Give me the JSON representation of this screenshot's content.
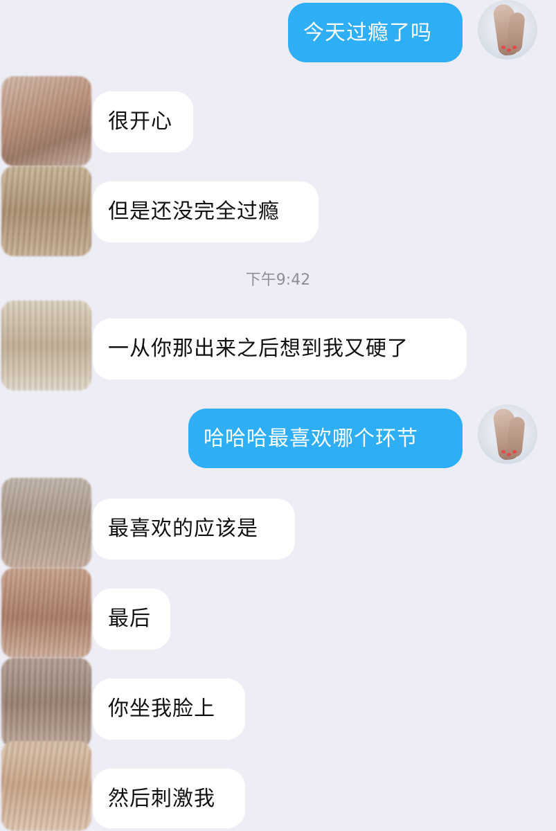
{
  "chat": {
    "timestamp": "下午9:42",
    "messages": [
      {
        "from": "me",
        "text": "今天过瘾了吗"
      },
      {
        "from": "other",
        "text": "很开心"
      },
      {
        "from": "other",
        "text": "但是还没完全过瘾"
      },
      {
        "from": "other",
        "text": "一从你那出来之后想到我又硬了"
      },
      {
        "from": "me",
        "text": "哈哈哈最喜欢哪个环节"
      },
      {
        "from": "other",
        "text": "最喜欢的应该是"
      },
      {
        "from": "other",
        "text": "最后"
      },
      {
        "from": "other",
        "text": "你坐我脸上"
      },
      {
        "from": "other",
        "text": "然后刺激我"
      }
    ]
  },
  "colors": {
    "background": "#ededf5",
    "outgoing_bubble": "#2eaef5",
    "incoming_bubble": "#ffffff",
    "timestamp_text": "#8e8e96"
  },
  "icons": {
    "my_avatar": "feet-photo-avatar",
    "contact_avatar": "blurred-avatar"
  }
}
